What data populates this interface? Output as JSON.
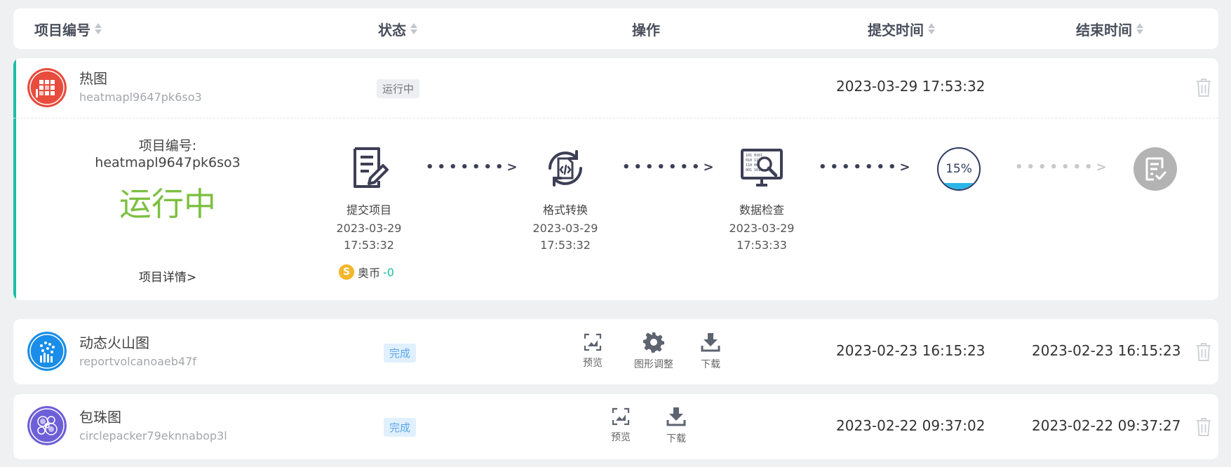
{
  "header": {
    "col_id": "项目编号",
    "col_status": "状态",
    "col_action": "操作",
    "col_submit": "提交时间",
    "col_end": "结束时间"
  },
  "rows": [
    {
      "name": "热图",
      "code": "heatmapl9647pk6so3",
      "status": "运行中",
      "submit_time": "2023-03-29 17:53:32",
      "end_time": "",
      "avatar_color": "#e84c3d",
      "detail": {
        "code_label": "项目编号:",
        "code_value": "heatmapl9647pk6so3",
        "status_big": "运行中",
        "detail_link": "项目详情>",
        "coin_icon": "S",
        "coin_label": "奥币",
        "coin_value": "-0",
        "arrow_text": "•••••••>",
        "steps": [
          {
            "name": "提交项目",
            "date": "2023-03-29",
            "time": "17:53:32",
            "icon": "document-edit-icon"
          },
          {
            "name": "格式转换",
            "date": "2023-03-29",
            "time": "17:53:32",
            "icon": "code-convert-icon"
          },
          {
            "name": "数据检查",
            "date": "2023-03-29",
            "time": "17:53:33",
            "icon": "data-check-icon"
          }
        ],
        "progress_text": "15%",
        "progress_value": 0.15,
        "final_icon": "report-check-icon"
      }
    },
    {
      "name": "动态火山图",
      "code": "reportvolcanoaeb47f",
      "status": "完成",
      "submit_time": "2023-02-23 16:15:23",
      "end_time": "2023-02-23 16:15:23",
      "avatar_color": "#1a8de8",
      "actions": [
        {
          "label": "预览",
          "icon": "preview-icon"
        },
        {
          "label": "图形调整",
          "icon": "gear-icon"
        },
        {
          "label": "下载",
          "icon": "download-icon"
        }
      ]
    },
    {
      "name": "包珠图",
      "code": "circlepacker79eknnabop3l",
      "status": "完成",
      "submit_time": "2023-02-22 09:37:02",
      "end_time": "2023-02-22 09:37:27",
      "avatar_color": "#6d5fd8",
      "actions": [
        {
          "label": "预览",
          "icon": "preview-icon"
        },
        {
          "label": "下载",
          "icon": "download-icon"
        }
      ]
    }
  ]
}
